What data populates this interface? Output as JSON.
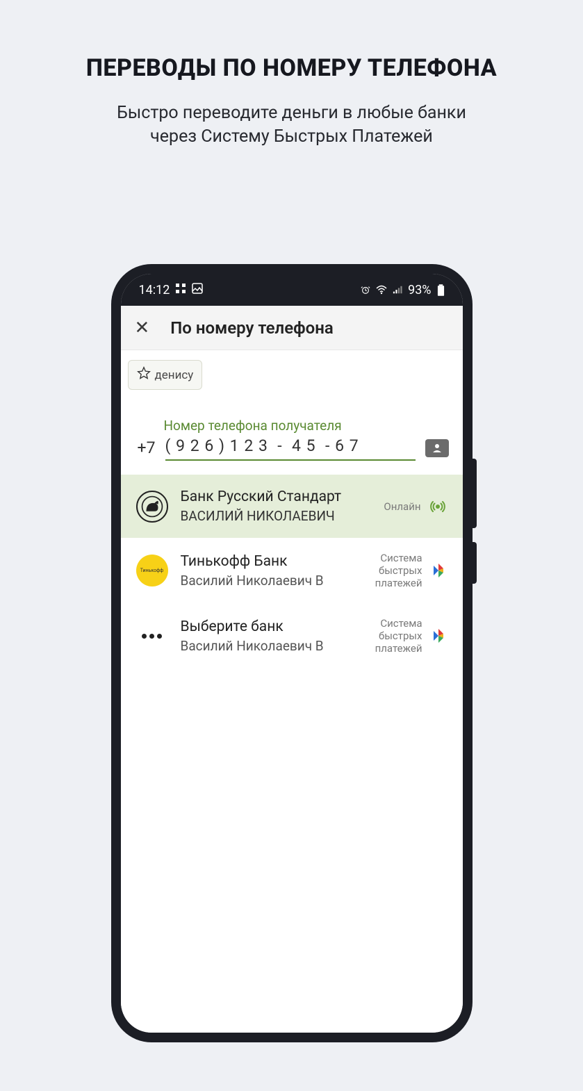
{
  "promo": {
    "title": "ПЕРЕВОДЫ ПО НОМЕРУ ТЕЛЕФОНА",
    "subtitle_line1": "Быстро переводите деньги в любые банки",
    "subtitle_line2": "через Систему Быстрых Платежей"
  },
  "status_bar": {
    "time": "14:12",
    "battery": "93%"
  },
  "app_header": {
    "title": "По номеру телефона"
  },
  "favorite_chip": {
    "label": "денису"
  },
  "phone_field": {
    "label": "Номер телефона получателя",
    "prefix": "+7",
    "value": "( 9 2 6 ) 1 2 3  -  4 5  - 6 7"
  },
  "banks": [
    {
      "name": "Банк Русский Стандарт",
      "person": "ВАСИЛИЙ НИКОЛАЕВИЧ",
      "right_label": "Онлайн",
      "selected": true,
      "logo": "rs",
      "badge": "online"
    },
    {
      "name": "Тинькофф Банк",
      "person": "Василий Николаевич В",
      "right_label": "Система\nбыстрых\nплатежей",
      "selected": false,
      "logo": "tinkoff",
      "badge": "sbp"
    },
    {
      "name": "Выберите банк",
      "person": "Василий Николаевич В",
      "right_label": "Система\nбыстрых\nплатежей",
      "selected": false,
      "logo": "dots",
      "badge": "sbp"
    }
  ]
}
